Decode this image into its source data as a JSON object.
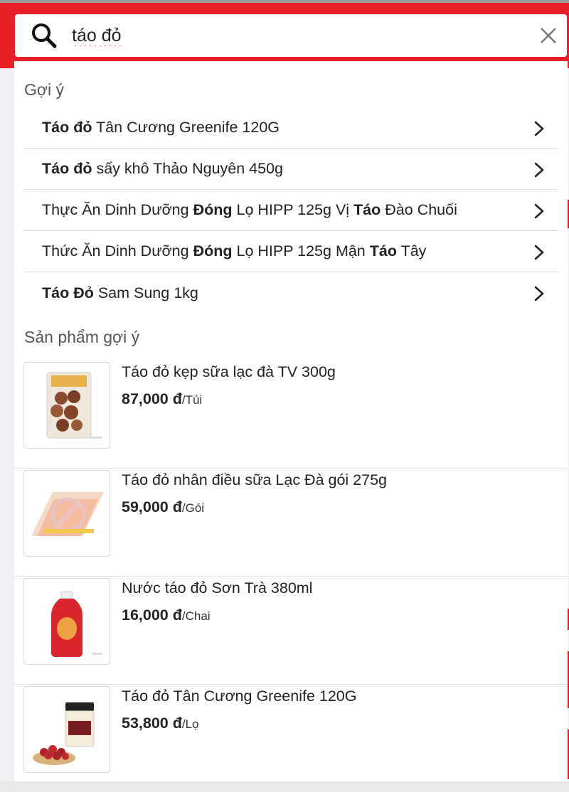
{
  "search": {
    "value": "táo đỏ"
  },
  "suggestions": {
    "title": "Gợi ý",
    "items": [
      {
        "parts": [
          {
            "t": "Táo đỏ",
            "b": true
          },
          {
            "t": " Tân Cương Greenife 120G",
            "b": false
          }
        ]
      },
      {
        "parts": [
          {
            "t": "Táo đỏ",
            "b": true
          },
          {
            "t": " sấy khô Thảo Nguyên 450g",
            "b": false
          }
        ]
      },
      {
        "parts": [
          {
            "t": "Thực Ăn Dinh Dưỡng ",
            "b": false
          },
          {
            "t": "Đóng",
            "b": true
          },
          {
            "t": " Lọ HIPP 125g Vị ",
            "b": false
          },
          {
            "t": "Táo",
            "b": true
          },
          {
            "t": " Đào Chuối",
            "b": false
          }
        ]
      },
      {
        "parts": [
          {
            "t": "Thức Ăn Dinh Dưỡng ",
            "b": false
          },
          {
            "t": "Đóng",
            "b": true
          },
          {
            "t": " Lọ HIPP 125g Mận ",
            "b": false
          },
          {
            "t": "Táo",
            "b": true
          },
          {
            "t": " Tây",
            "b": false
          }
        ]
      },
      {
        "parts": [
          {
            "t": "Táo Đỏ",
            "b": true
          },
          {
            "t": " Sam Sung 1kg",
            "b": false
          }
        ]
      }
    ]
  },
  "products": {
    "title": "Sản phẩm gợi ý",
    "items": [
      {
        "name": "Táo đỏ kẹp sữa lạc đà TV 300g",
        "price": "87,000 đ",
        "unit": "/Túi",
        "image": "bag-of-dates"
      },
      {
        "name": "Táo đỏ nhân điều sữa Lạc Đà gói 275g",
        "price": "59,000 đ",
        "unit": "/Gói",
        "image": "placeholder-logo"
      },
      {
        "name": "Nước táo đỏ Sơn Trà 380ml",
        "price": "16,000 đ",
        "unit": "/Chai",
        "image": "red-bottle"
      },
      {
        "name": "Táo đỏ Tân Cương Greenife 120G",
        "price": "53,800 đ",
        "unit": "/Lọ",
        "image": "jar-and-dates"
      }
    ]
  },
  "colors": {
    "brand_red": "#e8202a"
  }
}
